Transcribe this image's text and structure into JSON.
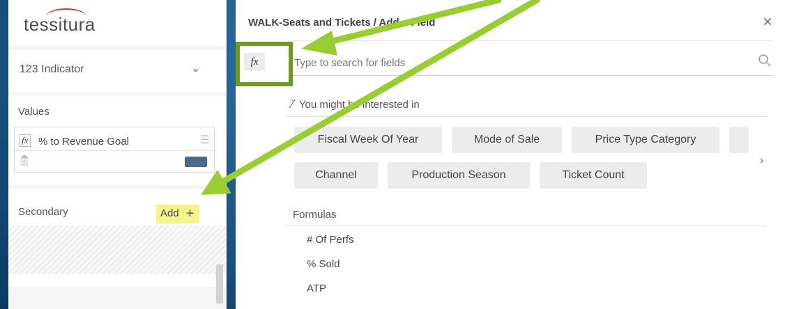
{
  "logo": {
    "text": "tessitura"
  },
  "left_panel": {
    "indicator": {
      "label": "123  Indicator"
    },
    "values": {
      "header": "Values",
      "item": {
        "fx": "fx",
        "name": "% to Revenue Goal",
        "color": "#4a6b85"
      }
    },
    "secondary": {
      "header": "Secondary",
      "add_label": "Add",
      "add_plus": "+"
    }
  },
  "dialog": {
    "title": "WALK-Seats and Tickets  / Add a Field",
    "close": "×",
    "fx_label": "fx",
    "search_placeholder": "Type to search for fields",
    "interested_header": "You might be interested in",
    "chips": [
      {
        "label": "Fiscal Week Of Year"
      },
      {
        "label": "Mode of Sale"
      },
      {
        "label": "Price Type Category"
      },
      {
        "label": "Channel"
      },
      {
        "label": "Production Season"
      },
      {
        "label": "Ticket Count"
      }
    ],
    "more_arrow": "›",
    "formulas_header": "Formulas",
    "formulas": [
      {
        "label": "# Of Perfs"
      },
      {
        "label": "% Sold"
      },
      {
        "label": "ATP"
      }
    ]
  },
  "annotation": {
    "arrow_color": "#9acd32",
    "box_color": "#6f9a1e"
  }
}
